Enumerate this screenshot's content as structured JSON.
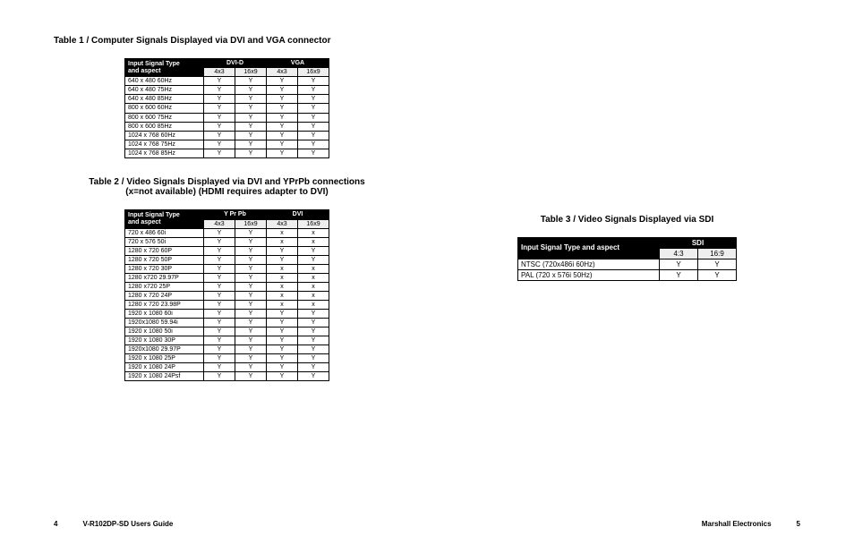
{
  "table1": {
    "title": "Table 1 / Computer Signals Displayed via DVI and VGA connector",
    "colGroup1": "DVI-D",
    "colGroup2": "VGA",
    "sigHeader": "Input Signal Type\nand aspect",
    "sub": [
      "4x3",
      "16x9",
      "4x3",
      "16x9"
    ],
    "rows": [
      [
        "640 x 480 60Hz",
        "Y",
        "Y",
        "Y",
        "Y"
      ],
      [
        "640 x 480 75Hz",
        "Y",
        "Y",
        "Y",
        "Y"
      ],
      [
        "640 x 480 85Hz",
        "Y",
        "Y",
        "Y",
        "Y"
      ],
      [
        "800 x 600 60Hz",
        "Y",
        "Y",
        "Y",
        "Y"
      ],
      [
        "800 x 600 75Hz",
        "Y",
        "Y",
        "Y",
        "Y"
      ],
      [
        "800 x 600 85Hz",
        "Y",
        "Y",
        "Y",
        "Y"
      ],
      [
        "1024 x 768 60Hz",
        "Y",
        "Y",
        "Y",
        "Y"
      ],
      [
        "1024 x 768 75Hz",
        "Y",
        "Y",
        "Y",
        "Y"
      ],
      [
        "1024 x 768 85Hz",
        "Y",
        "Y",
        "Y",
        "Y"
      ]
    ]
  },
  "table2": {
    "title1": "Table 2 / Video Signals Displayed via DVI and YPrPb connections",
    "title2": "(x=not available) (HDMI requires adapter to DVI)",
    "colGroup1": "Y Pr Pb",
    "colGroup2": "DVI",
    "sigHeader": "Input Signal Type\nand aspect",
    "sub": [
      "4x3",
      "16x9",
      "4x3",
      "16x9"
    ],
    "rows": [
      [
        "720 x 486 60i",
        "Y",
        "Y",
        "x",
        "x"
      ],
      [
        "720 x 576 50i",
        "Y",
        "Y",
        "x",
        "x"
      ],
      [
        "1280 x 720 60P",
        "Y",
        "Y",
        "Y",
        "Y"
      ],
      [
        "1280 x 720 50P",
        "Y",
        "Y",
        "Y",
        "Y"
      ],
      [
        "1280 x 720 30P",
        "Y",
        "Y",
        "x",
        "x"
      ],
      [
        "1280 x720 29.97P",
        "Y",
        "Y",
        "x",
        "x"
      ],
      [
        "1280 x720 25P",
        "Y",
        "Y",
        "x",
        "x"
      ],
      [
        "1280 x 720 24P",
        "Y",
        "Y",
        "x",
        "x"
      ],
      [
        "1280 x 720 23.98P",
        "Y",
        "Y",
        "x",
        "x"
      ],
      [
        "1920 x 1080 60i",
        "Y",
        "Y",
        "Y",
        "Y"
      ],
      [
        "1920x1080 59.94i",
        "Y",
        "Y",
        "Y",
        "Y"
      ],
      [
        "1920 x 1080 50i",
        "Y",
        "Y",
        "Y",
        "Y"
      ],
      [
        "1920 x 1080 30P",
        "Y",
        "Y",
        "Y",
        "Y"
      ],
      [
        "1920x1080 29.97P",
        "Y",
        "Y",
        "Y",
        "Y"
      ],
      [
        "1920 x 1080 25P",
        "Y",
        "Y",
        "Y",
        "Y"
      ],
      [
        "1920 x 1080 24P",
        "Y",
        "Y",
        "Y",
        "Y"
      ],
      [
        "1920 x 1080 24Psf",
        "Y",
        "Y",
        "Y",
        "Y"
      ]
    ]
  },
  "table3": {
    "title": "Table 3 / Video Signals Displayed via SDI",
    "colGroup": "SDI",
    "sigHeader": "Input Signal Type and aspect",
    "sub": [
      "4:3",
      "16:9"
    ],
    "rows": [
      [
        "NTSC (720x486i 60Hz)",
        "Y",
        "Y"
      ],
      [
        "PAL (720 x 576i 50Hz)",
        "Y",
        "Y"
      ]
    ]
  },
  "footer": {
    "pageLeft": "4",
    "guide": "V-R102DP-SD Users Guide",
    "brand": "Marshall Electronics",
    "pageRight": "5"
  }
}
